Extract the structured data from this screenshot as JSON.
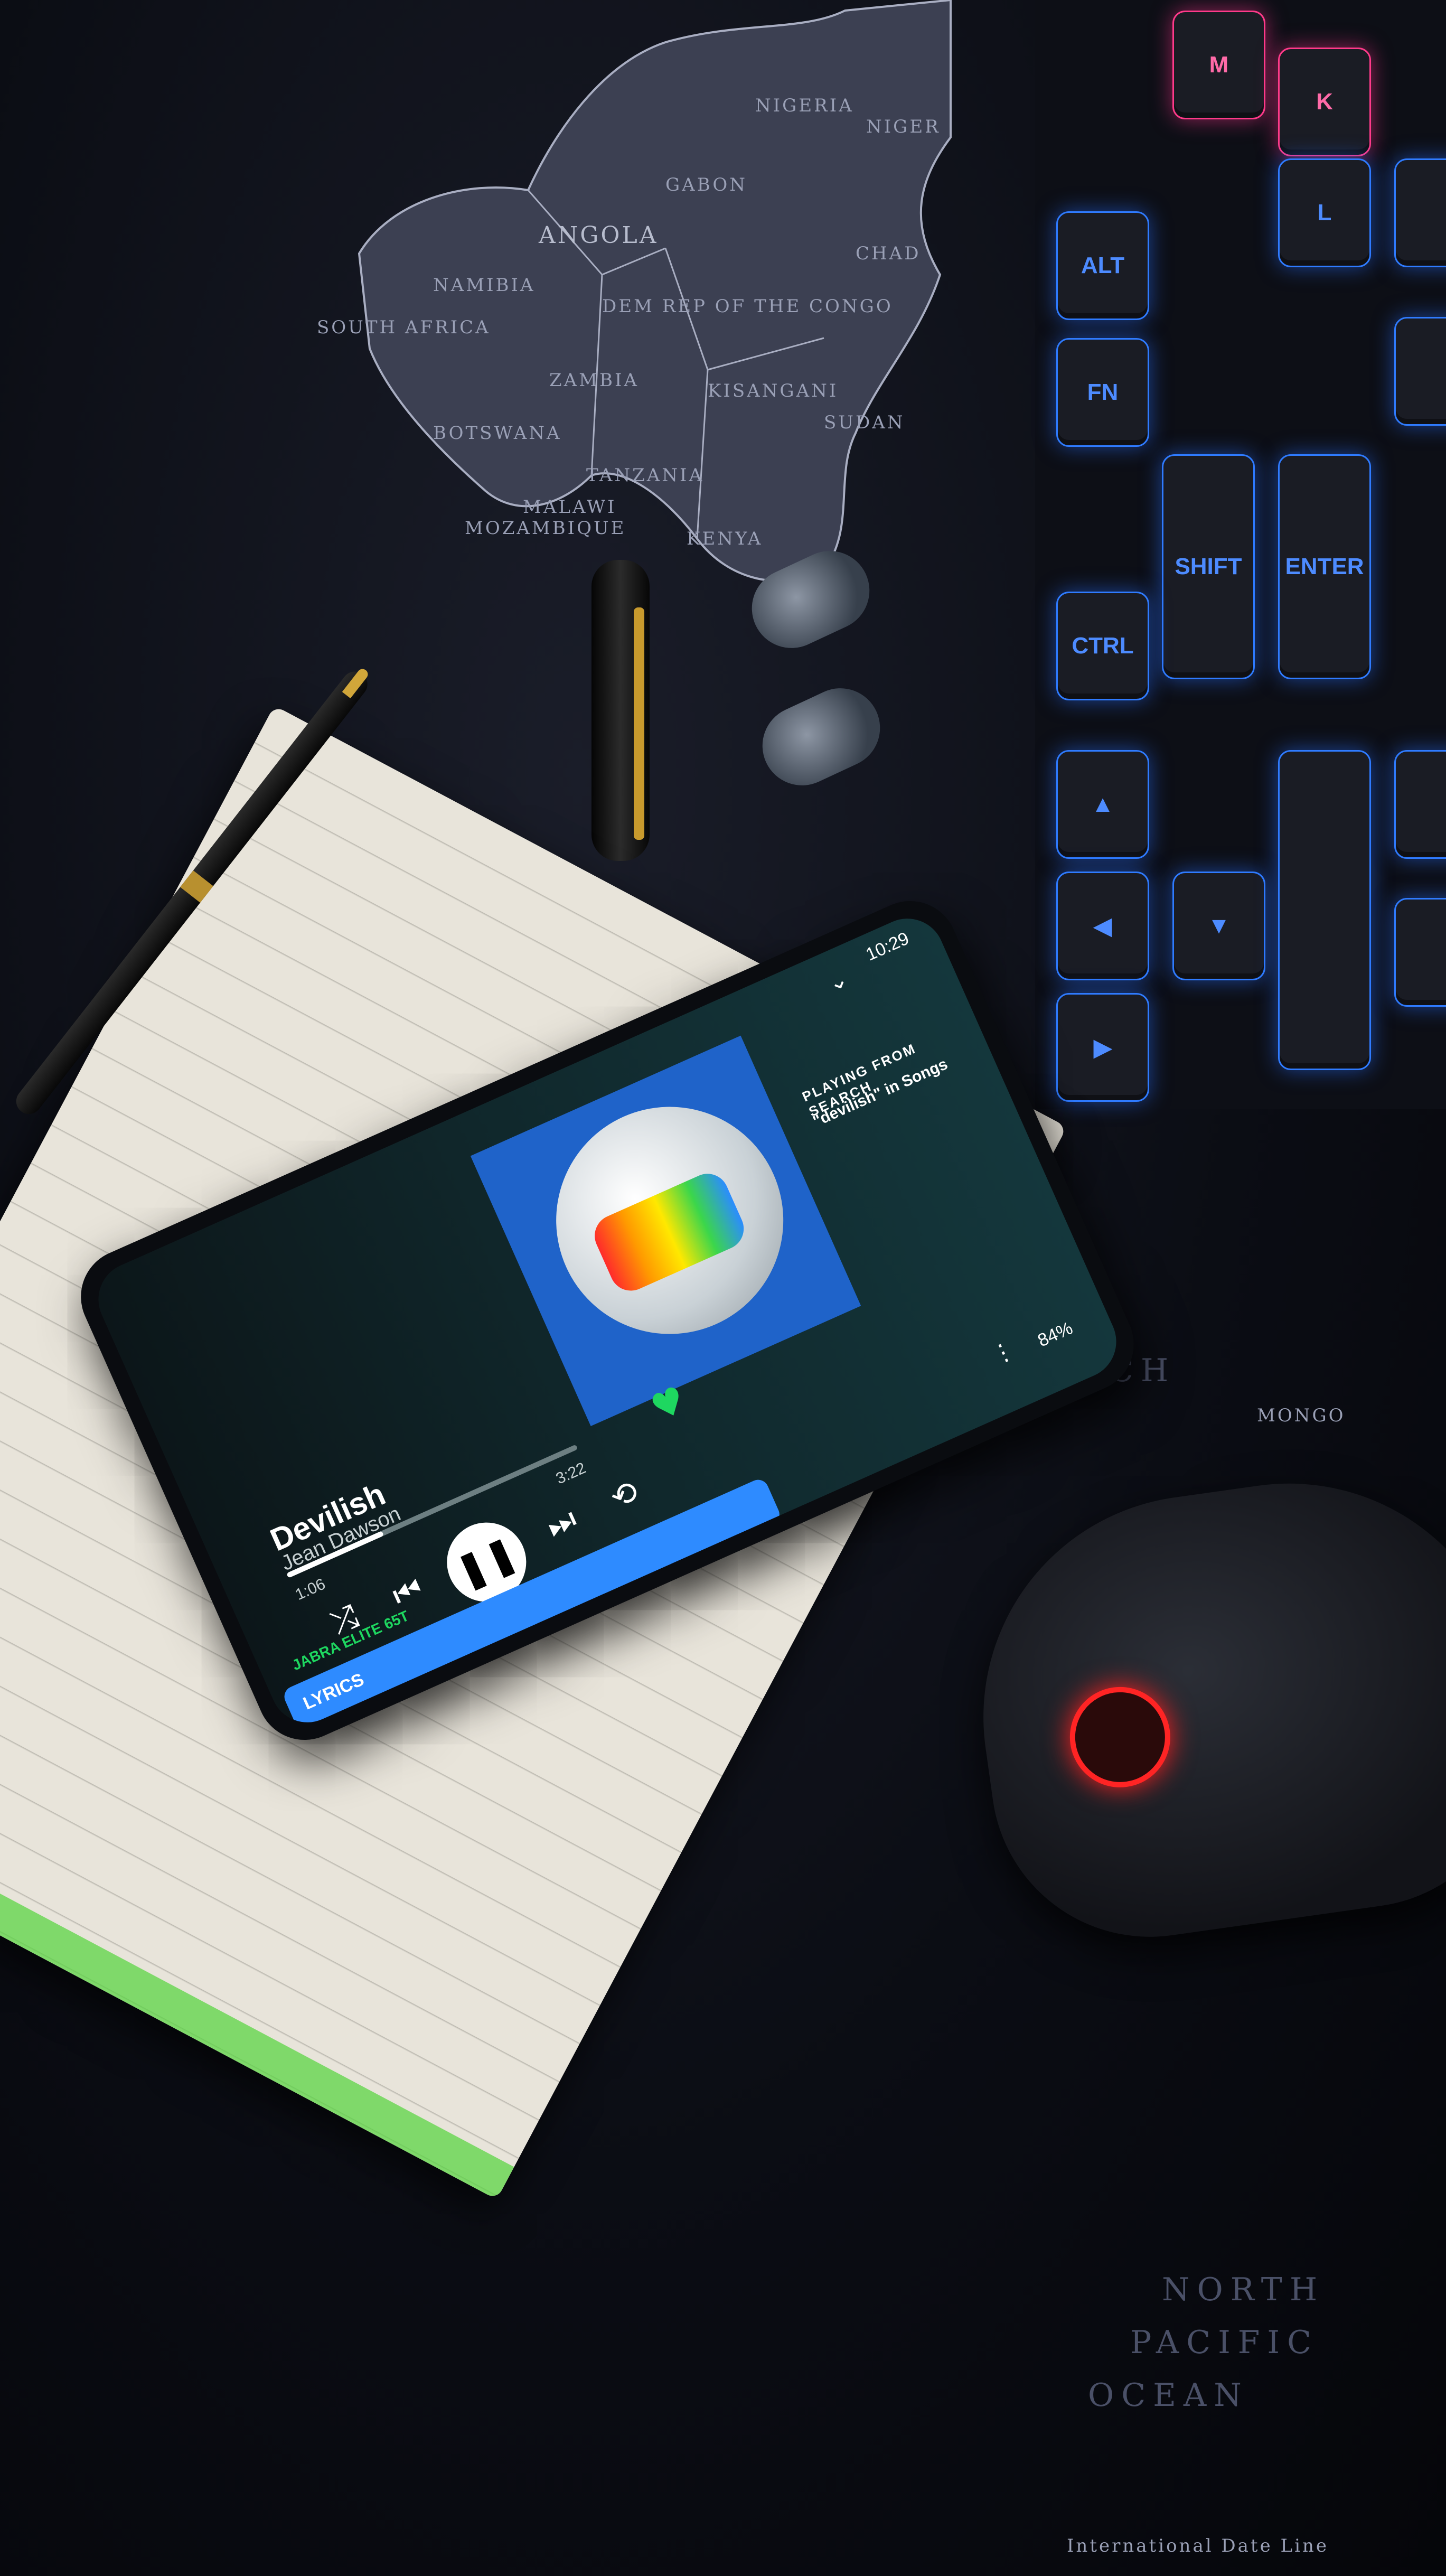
{
  "map": {
    "labels": [
      "ANGOLA",
      "NAMIBIA",
      "SOUTH AFRICA",
      "ZAMBIA",
      "SUDAN",
      "NIGER",
      "CHAD",
      "NIGERIA",
      "GABON",
      "DEM REP OF THE CONGO",
      "KISANGANI",
      "TANZANIA",
      "MOZAMBIQUE",
      "MALAWI",
      "KENYA",
      "BOTSWANA",
      "CH",
      "MONGO",
      "NORTH",
      "PACIFIC",
      "OCEAN",
      "International Date Line"
    ]
  },
  "keyboard": {
    "keys": [
      "M",
      "K",
      "L",
      "ALT",
      "FN",
      "SHIFT",
      "ENTER",
      "CTRL"
    ]
  },
  "phone": {
    "status": {
      "time": "10:29",
      "battery": "84%"
    },
    "header": {
      "line1": "PLAYING FROM SEARCH",
      "line2": "\"devilish\" in Songs"
    },
    "track": {
      "title": "Devilish",
      "artist": "Jean Dawson"
    },
    "progress": {
      "elapsed": "1:06",
      "duration": "3:22",
      "fraction": 0.33
    },
    "device_label": "JABRA ELITE 65T",
    "lyrics_label": "LYRICS",
    "icons": {
      "shuffle": "shuffle-icon",
      "previous": "previous-icon",
      "play_pause": "pause-icon",
      "next": "next-icon",
      "repeat": "repeat-icon",
      "like": "heart-icon",
      "share": "share-icon",
      "queue": "queue-icon",
      "more": "more-icon",
      "collapse": "chevron-down-icon"
    },
    "colors": {
      "accent": "#1ed760",
      "lyrics_bg": "#2e8bff"
    }
  },
  "notebook": {
    "edge_color": "#52d43a"
  },
  "mouse": {
    "logo_color": "#ff2424"
  }
}
